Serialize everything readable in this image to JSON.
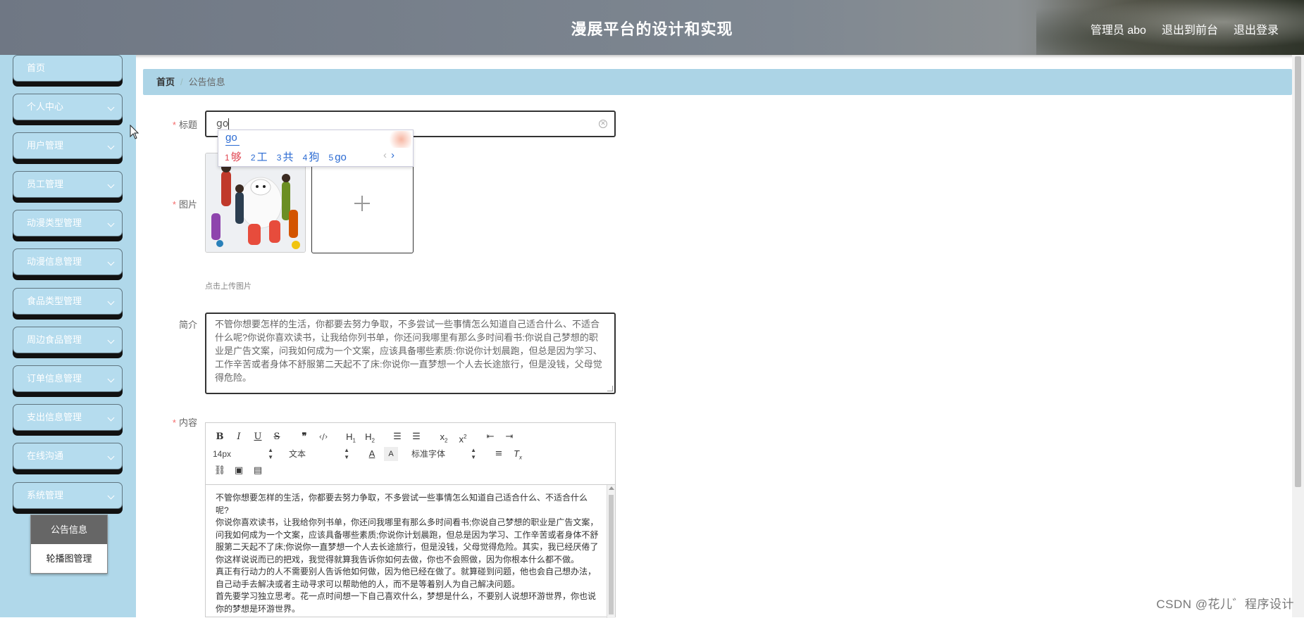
{
  "header": {
    "title": "漫展平台的设计和实现",
    "admin_label": "管理员 abo",
    "front_link": "退出到前台",
    "logout_link": "退出登录"
  },
  "sidebar": {
    "items": [
      {
        "label": "首页"
      },
      {
        "label": "个人中心"
      },
      {
        "label": "用户管理"
      },
      {
        "label": "员工管理"
      },
      {
        "label": "动漫类型管理"
      },
      {
        "label": "动漫信息管理"
      },
      {
        "label": "食品类型管理"
      },
      {
        "label": "周边食品管理"
      },
      {
        "label": "订单信息管理"
      },
      {
        "label": "支出信息管理"
      },
      {
        "label": "在线沟通"
      },
      {
        "label": "系统管理"
      }
    ],
    "submenu": {
      "items": [
        {
          "label": "公告信息",
          "active": true
        },
        {
          "label": "轮播图管理",
          "active": false
        }
      ]
    }
  },
  "breadcrumb": {
    "home": "首页",
    "separator": "/",
    "current": "公告信息"
  },
  "form": {
    "required_mark": "*",
    "title_label": "标题",
    "title_value": "go",
    "image_label": "图片",
    "upload_hint": "点击上传图片",
    "intro_label": "简介",
    "intro_text": "不管你想要怎样的生活，你都要去努力争取，不多尝试一些事情怎么知道自己适合什么、不适合什么呢?你说你喜欢读书，让我给你列书单，你还问我哪里有那么多时间看书:你说自己梦想的职业是广告文案，问我如何成为一个文案，应该具备哪些素质:你说你计划晨跑，但总是因为学习、工作辛苦或者身体不舒服第二天起不了床:你说你一直梦想一个人去长途旅行，但是没钱，父母觉得危险。",
    "content_label": "内容"
  },
  "ime": {
    "composition": "go",
    "candidates": [
      {
        "num": "1",
        "text": "够"
      },
      {
        "num": "2",
        "text": "工"
      },
      {
        "num": "3",
        "text": "共"
      },
      {
        "num": "4",
        "text": "狗"
      },
      {
        "num": "5",
        "text": "go"
      }
    ],
    "prev": "‹",
    "next": "›"
  },
  "editor": {
    "font_size": "14px",
    "block_type": "文本",
    "font_family": "标准字体",
    "paragraphs": [
      "不管你想要怎样的生活，你都要去努力争取，不多尝试一些事情怎么知道自己适合什么、不适合什么呢?",
      "你说你喜欢读书，让我给你列书单，你还问我哪里有那么多时间看书;你说自己梦想的职业是广告文案，问我如何成为一个文案，应该具备哪些素质;你说你计划晨跑，但总是因为学习、工作辛苦或者身体不舒服第二天起不了床;你说你一直梦想一个人去长途旅行，但是没钱，父母觉得危险。其实，我已经厌倦了你这样说说而已的把戏，我觉得就算我告诉你如何去做，你也不会照做，因为你根本什么都不做。",
      "真正有行动力的人不需要别人告诉他如何做，因为他已经在做了。就算碰到问题，他也会自己想办法，自己动手去解决或者主动寻求可以帮助他的人，而不是等着别人为自己解决问题。",
      "首先要学习独立思考。花一点时间想一下自己喜欢什么，梦想是什么，不要别人说想环游世界，你也说你的梦想是环游世界。"
    ]
  },
  "watermark": "CSDN @花儿゛程序设计",
  "colors": {
    "sidebar_bg": "#b0d8ea",
    "breadcrumb_bg": "#acd4e6",
    "required": "#f56c6c",
    "ime_blue": "#2a6ad2",
    "ime_first": "#e0434f"
  }
}
